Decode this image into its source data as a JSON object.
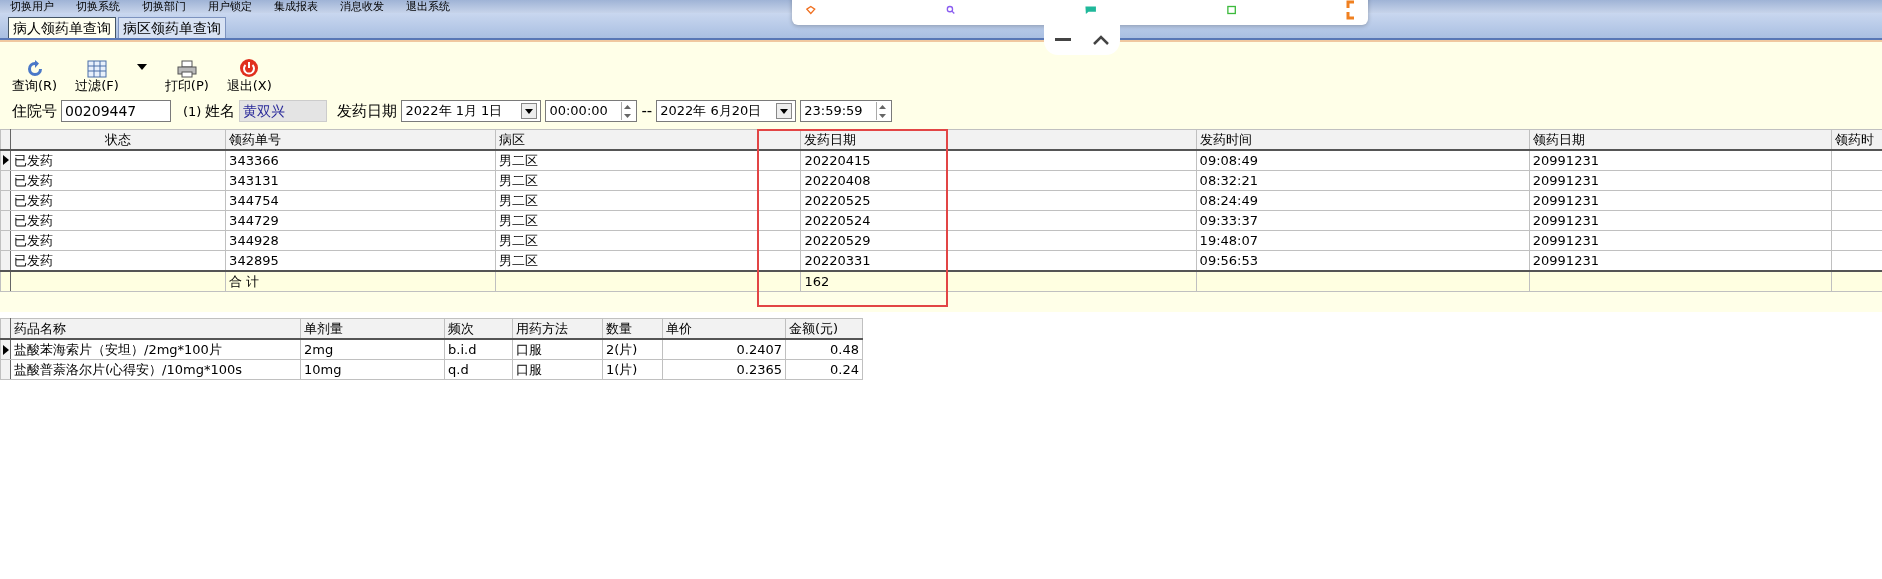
{
  "menu_bar": [
    "切换用户",
    "切换系统",
    "切换部门",
    "用户锁定",
    "集成报表",
    "消息收发",
    "退出系统"
  ],
  "tabs": [
    {
      "label": "病人领药单查询",
      "selected": true
    },
    {
      "label": "病区领药单查询",
      "selected": false
    }
  ],
  "toolbar": [
    {
      "kind": "refresh",
      "label": "查询(R)"
    },
    {
      "kind": "filter",
      "label": "过滤(F)"
    },
    {
      "kind": "dropdown"
    },
    {
      "kind": "print",
      "label": "打印(P)"
    },
    {
      "kind": "exit",
      "label": "退出(X)"
    }
  ],
  "form": {
    "inpatient_label": "住院号",
    "inpatient_value": "00209447",
    "count": "(1)",
    "name_label": "姓名",
    "name_value": "黄双兴",
    "date_label": "发药日期",
    "from_date": "2022年 1月 1日",
    "from_time": "00:00:00",
    "separator": "--",
    "to_date": "2022年 6月20日",
    "to_time": "23:59:59"
  },
  "orders": {
    "columns": [
      "状态",
      "领药单号",
      "病区",
      "发药日期",
      "发药时间",
      "领药日期",
      "领药时"
    ],
    "rows": [
      {
        "selected": true,
        "cells": [
          "已发药",
          "343366",
          "男二区",
          "20220415",
          "09:08:49",
          "20991231",
          ""
        ]
      },
      {
        "selected": false,
        "cells": [
          "已发药",
          "343131",
          "男二区",
          "20220408",
          "08:32:21",
          "20991231",
          ""
        ]
      },
      {
        "selected": false,
        "cells": [
          "已发药",
          "344754",
          "男二区",
          "20220525",
          "08:24:49",
          "20991231",
          ""
        ]
      },
      {
        "selected": false,
        "cells": [
          "已发药",
          "344729",
          "男二区",
          "20220524",
          "09:33:37",
          "20991231",
          ""
        ]
      },
      {
        "selected": false,
        "cells": [
          "已发药",
          "344928",
          "男二区",
          "20220529",
          "19:48:07",
          "20991231",
          ""
        ]
      },
      {
        "selected": false,
        "cells": [
          "已发药",
          "342895",
          "男二区",
          "20220331",
          "09:56:53",
          "20991231",
          ""
        ]
      }
    ],
    "total": {
      "label": "合  计",
      "dispense_date_sum": "162"
    }
  },
  "drugs": {
    "columns": [
      "药品名称",
      "单剂量",
      "频次",
      "用药方法",
      "数量",
      "单价",
      "金额(元)"
    ],
    "rows": [
      {
        "selected": true,
        "cells": [
          "盐酸苯海索片（安坦）/2mg*100片",
          "2mg",
          "b.i.d",
          "口服",
          "2(片)",
          "0.2407",
          "0.48"
        ]
      },
      {
        "selected": false,
        "cells": [
          "盐酸普萘洛尔片(心得安）/10mg*100s",
          "10mg",
          "q.d",
          "口服",
          "1(片)",
          "0.2365",
          "0.24"
        ]
      }
    ]
  },
  "floating_panel": {
    "items": [
      {
        "kind": "action"
      },
      {
        "kind": "search"
      },
      {
        "kind": "chat"
      },
      {
        "kind": "file"
      }
    ]
  }
}
